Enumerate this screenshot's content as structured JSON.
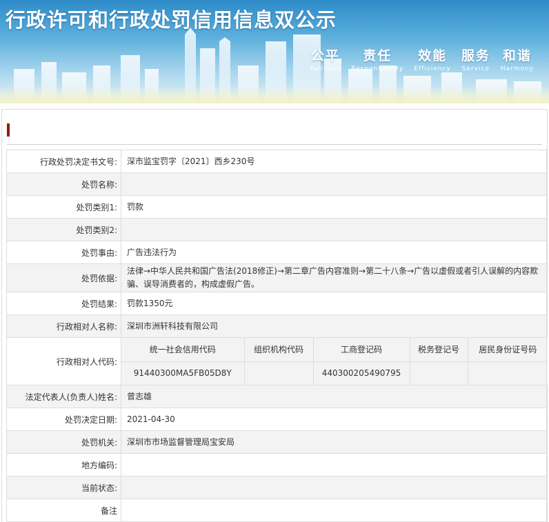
{
  "banner": {
    "title": "行政许可和行政处罚信用信息双公示",
    "slogans": [
      {
        "zh": "公平",
        "en": "Fairness"
      },
      {
        "zh": "责任",
        "en": "Responsibility"
      },
      {
        "zh": "效能",
        "en": "Efficiency"
      },
      {
        "zh": "服务",
        "en": "Service"
      },
      {
        "zh": "和谐",
        "en": "Harmony"
      }
    ]
  },
  "record": {
    "decision_no": {
      "label": "行政处罚决定书文号:",
      "value": "深市监宝罚字〔2021〕西乡230号"
    },
    "penalty_name": {
      "label": "处罚名称:",
      "value": ""
    },
    "category1": {
      "label": "处罚类别1:",
      "value": "罚款"
    },
    "category2": {
      "label": "处罚类别2:",
      "value": ""
    },
    "reason": {
      "label": "处罚事由:",
      "value": "广告违法行为"
    },
    "basis": {
      "label": "处罚依据:",
      "value": "法律→中华人民共和国广告法(2018修正)→第二章广告内容准则→第二十八条→广告以虚假或者引人误解的内容欺骗、误导消费者的，构成虚假广告。"
    },
    "result": {
      "label": "处罚结果:",
      "value": "罚款1350元"
    },
    "party_name": {
      "label": "行政相对人名称:",
      "value": "深圳市洲轩科技有限公司"
    },
    "party_code": {
      "label": "行政相对人代码:",
      "headers": [
        "统一社会信用代码",
        "组织机构代码",
        "工商登记码",
        "税务登记号",
        "居民身份证号码"
      ],
      "values": [
        "91440300MA5FB05D8Y",
        "",
        "440300205490795",
        "",
        ""
      ]
    },
    "legal_rep": {
      "label": "法定代表人(负责人)姓名:",
      "value": "曾志雄"
    },
    "decision_date": {
      "label": "处罚决定日期:",
      "value": "2021-04-30"
    },
    "authority": {
      "label": "处罚机关:",
      "value": "深圳市市场监督管理局宝安局"
    },
    "region_code": {
      "label": "地方编码:",
      "value": ""
    },
    "status": {
      "label": "当前状态:",
      "value": ""
    },
    "remark": {
      "label": "备注",
      "value": ""
    }
  }
}
